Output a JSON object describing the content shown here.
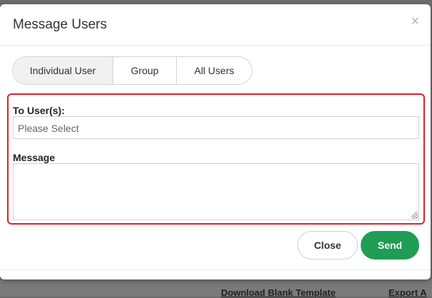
{
  "modal": {
    "title": "Message Users",
    "close_icon": "×",
    "tabs": [
      {
        "label": "Individual User",
        "active": true
      },
      {
        "label": "Group",
        "active": false
      },
      {
        "label": "All Users",
        "active": false
      }
    ],
    "to_label": "To User(s):",
    "to_placeholder": "Please Select",
    "message_label": "Message",
    "message_value": "",
    "close_button": "Close",
    "send_button": "Send"
  },
  "background": {
    "link_left": "Download Blank Template",
    "link_right": "Export A"
  },
  "colors": {
    "send": "#1f9d55",
    "highlight": "#e01f2d",
    "backdrop": "#6e6e6e"
  },
  "icons": {
    "close": "close-icon",
    "resize": "resize-grip-icon"
  }
}
